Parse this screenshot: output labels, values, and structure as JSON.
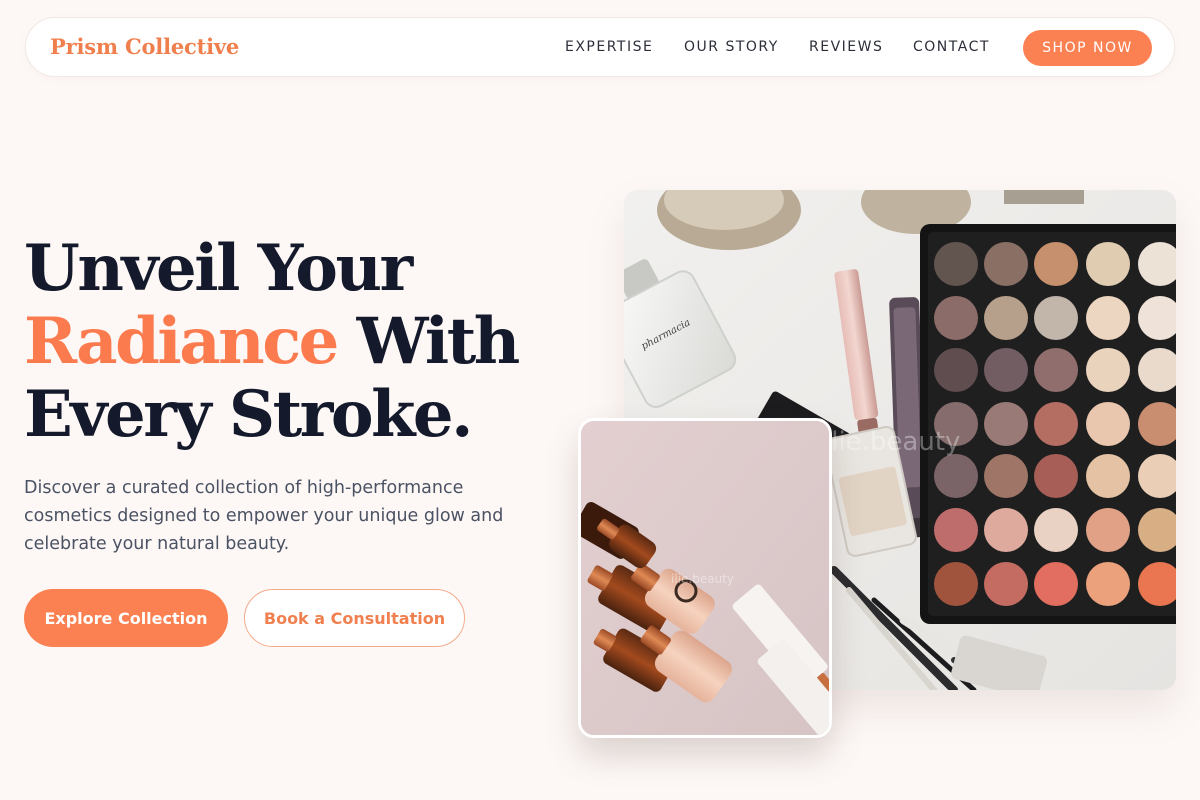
{
  "brand": {
    "name": "Prism Collective"
  },
  "nav": {
    "links": [
      "EXPERTISE",
      "OUR STORY",
      "REVIEWS",
      "CONTACT"
    ],
    "cta": "SHOP NOW"
  },
  "hero": {
    "headline_line1": "Unveil Your",
    "headline_accent": "Radiance",
    "headline_line2_rest": "With",
    "headline_line3": "Every Stroke.",
    "subtext": "Discover a curated collection of high-performance cosmetics designed to empower your unique glow and celebrate your natural beauty.",
    "primary_button": "Explore Collection",
    "secondary_button": "Book a Consultation"
  },
  "images": {
    "main_watermark": "ilie.beauty",
    "secondary_watermark": "ilie.beauty",
    "perfume_label": "pharmacia"
  },
  "colors": {
    "accent": "#fb8052",
    "heading": "#141a2b",
    "background": "#fdf8f6"
  }
}
